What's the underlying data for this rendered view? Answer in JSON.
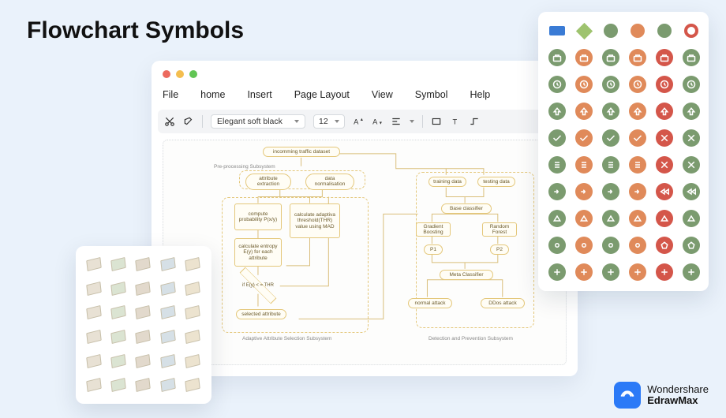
{
  "page": {
    "title": "Flowchart Symbols"
  },
  "brand": {
    "line1": "Wondershare",
    "line2": "EdrawMax"
  },
  "menu": {
    "file": "File",
    "home": "home",
    "insert": "Insert",
    "pageLayout": "Page Layout",
    "view": "View",
    "symbol": "Symbol",
    "help": "Help"
  },
  "toolbar": {
    "font": "Elegant soft black",
    "size": "12"
  },
  "canvas": {
    "subsystemLabel1": "Pre-processing Subsystem",
    "subsystemCaption1": "Adaptive Attribute Selection Subsystem",
    "subsystemCaption2": "Detection and Prevention Subsystem",
    "nodes": {
      "start": "incomming traffic dataset",
      "attrExt": "attribute extraction",
      "dataNorm": "data normalisation",
      "compProb": "compute probability P(x/y)",
      "calcThr": "calculate adaptiva threshold(THR) value using MAD",
      "entropy": "calculate entropy E(y) for each attribute",
      "cond": "if E(y) < = THR",
      "selected": "selected attribute",
      "train": "training data",
      "test": "testing data",
      "base": "Base classifier",
      "gradB": "Gradient Boosting",
      "randF": "Random Forest",
      "p1": "P1",
      "p2": "P2",
      "meta": "Meta Classifier",
      "normal": "normal attack",
      "ddos": "DDos attack"
    }
  },
  "symbolPalette": {
    "header": [
      {
        "shape": "rect",
        "color": "#3a7bd5"
      },
      {
        "shape": "diamond",
        "color": "#9ec36e"
      },
      {
        "shape": "circle",
        "color": "#7b9b6f"
      },
      {
        "shape": "circle",
        "color": "#e08a5a"
      },
      {
        "shape": "circle",
        "color": "#7b9b6f"
      },
      {
        "shape": "ring",
        "color": "#d4564a"
      }
    ],
    "rows": [
      [
        "briefcase",
        "briefcase",
        "briefcase",
        "briefcase",
        "briefcase",
        "briefcase"
      ],
      [
        "clock",
        "clock",
        "clock",
        "clock",
        "clock",
        "clock"
      ],
      [
        "up",
        "up",
        "up",
        "up",
        "up",
        "up"
      ],
      [
        "check",
        "check",
        "check",
        "check",
        "cross",
        "cross"
      ],
      [
        "list",
        "list",
        "list",
        "list",
        "cross",
        "cross"
      ],
      [
        "right",
        "right",
        "right",
        "right",
        "rewind",
        "rewind"
      ],
      [
        "tri-up",
        "tri-up",
        "tri-up",
        "tri-up",
        "tri-up",
        "tri-up"
      ],
      [
        "dot",
        "dot",
        "dot",
        "dot",
        "pentagon",
        "pentagon"
      ],
      [
        "plus",
        "plus",
        "plus",
        "plus",
        "plus",
        "plus"
      ]
    ],
    "colors": [
      "#7b9b6f",
      "#e08a5a",
      "#7b9b6f",
      "#e08a5a",
      "#d4564a",
      "#7b9b6f"
    ]
  }
}
